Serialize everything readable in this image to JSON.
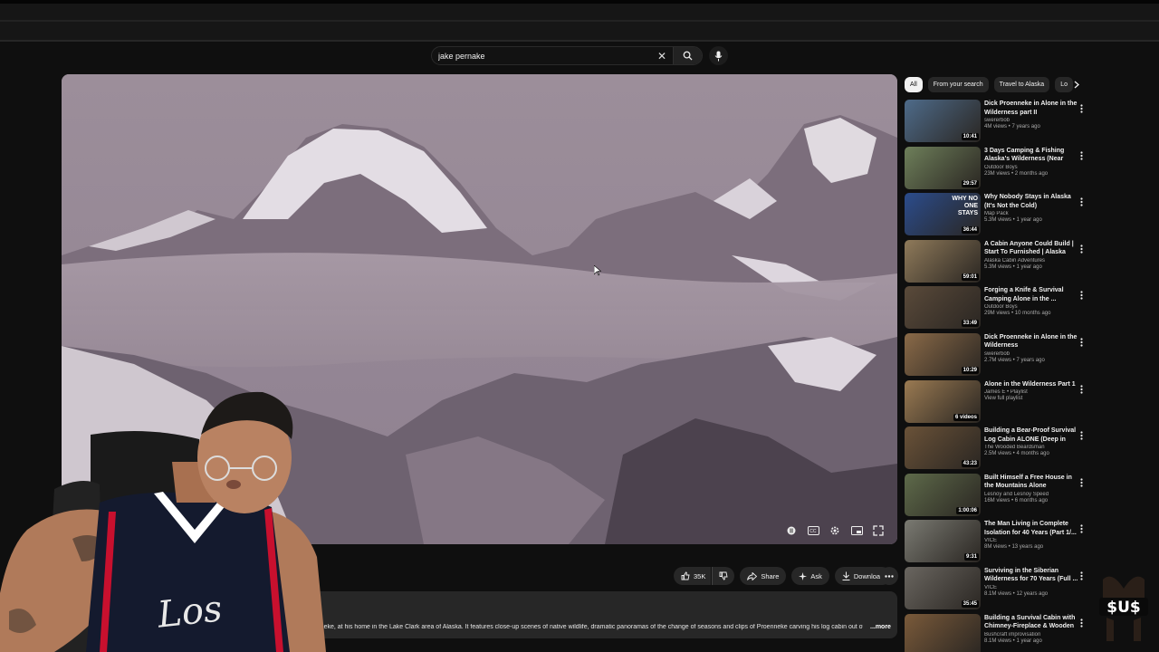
{
  "search": {
    "value": "jake pernake"
  },
  "actions": {
    "likes": "35K",
    "share": "Share",
    "ask": "Ask",
    "download": "Download"
  },
  "description": {
    "text": "Proenneke, at his home in the Lake Clark area of Alaska. It features close-up scenes of native wildlife, dramatic panoramas of the change of seasons and clips of Proenneke carving his log cabin out of",
    "more": "...more"
  },
  "chips": [
    "All",
    "From your search",
    "Travel to Alaska",
    "Lo"
  ],
  "related": [
    {
      "title": "Dick Proenneke in Alone in the Wilderness part II",
      "channel": "swererbob",
      "meta": "4M views • 7 years ago",
      "duration": "10:41",
      "thumb_color": "#4e6b8a"
    },
    {
      "title": "3 Days Camping & Fishing Alaska's Wilderness (Near Dic...",
      "channel": "Outdoor Boys",
      "meta": "23M views • 2 months ago",
      "duration": "29:57",
      "thumb_color": "#6e7f5a"
    },
    {
      "title": "Why Nobody Stays in Alaska (It's Not the Cold)",
      "channel": "Map Pack",
      "meta": "5.3M views • 1 year ago",
      "duration": "36:44",
      "thumb_color": "#2b4c8c",
      "overlay": "WHY NO ONE STAYS"
    },
    {
      "title": "A Cabin Anyone Could Build | Start To Furnished | Alaska Off...",
      "channel": "Alaska Cabin Adventures",
      "meta": "5.3M views • 1 year ago",
      "duration": "59:01",
      "thumb_color": "#8f7a5a"
    },
    {
      "title": "Forging a Knife & Survival Camping Alone in the ...",
      "channel": "Outdoor Boys",
      "meta": "29M views • 10 months ago",
      "duration": "33:49",
      "thumb_color": "#5a4a3a"
    },
    {
      "title": "Dick Proenneke in Alone in the Wilderness",
      "channel": "swererbob",
      "meta": "2.7M views • 7 years ago",
      "duration": "10:29",
      "thumb_color": "#8a6a48"
    },
    {
      "title": "Alone in the Wilderness Part 1",
      "channel": "James E • Playlist",
      "meta": "View full playlist",
      "duration": "6 videos",
      "thumb_color": "#9a7a52"
    },
    {
      "title": "Building a Bear-Proof Survival Log Cabin ALONE (Deep in the...",
      "channel": "The Wooded Beardsman",
      "meta": "2.5M views • 4 months ago",
      "duration": "43:23",
      "thumb_color": "#6a5238"
    },
    {
      "title": "Built Himself a Free House in the Mountains Alone",
      "channel": "Lesnoy and Lesnoy Speed",
      "meta": "16M views • 6 months ago",
      "duration": "1:00:06",
      "thumb_color": "#5e6a4a"
    },
    {
      "title": "The Man Living in Complete Isolation for 40 Years (Part 1/...",
      "channel": "VICE",
      "meta": "8M views • 13 years ago",
      "duration": "9:31",
      "thumb_color": "#7a7a72"
    },
    {
      "title": "Surviving in the Siberian Wilderness for 70 Years (Full ...",
      "channel": "VICE",
      "meta": "8.1M views • 12 years ago",
      "duration": "35:45",
      "thumb_color": "#6a6660"
    },
    {
      "title": "Building a Survival Cabin with Chimney-Fireplace & Wooden ...",
      "channel": "Bushcraft improvisation",
      "meta": "8.1M views • 1 year ago",
      "duration": "",
      "thumb_color": "#7a5a3a"
    }
  ],
  "logo_text": "$U$",
  "colors": {
    "background": "#0f0f0f",
    "pill": "#272727",
    "text": "#f1f1f1",
    "secondary_text": "#aaaaaa"
  }
}
